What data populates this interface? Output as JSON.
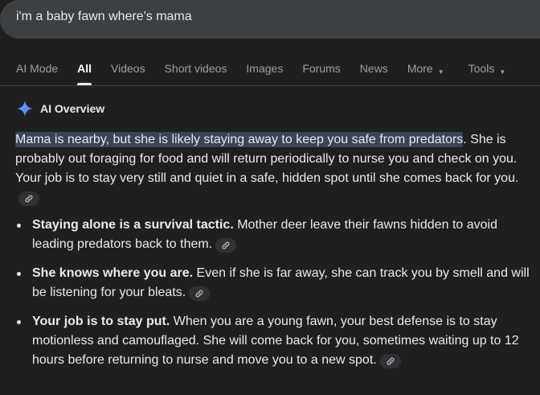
{
  "search": {
    "query": "i'm a baby fawn where's mama"
  },
  "tabs": [
    {
      "label": "AI Mode",
      "active": false,
      "dropdown": false
    },
    {
      "label": "All",
      "active": true,
      "dropdown": false
    },
    {
      "label": "Videos",
      "active": false,
      "dropdown": false
    },
    {
      "label": "Short videos",
      "active": false,
      "dropdown": false
    },
    {
      "label": "Images",
      "active": false,
      "dropdown": false
    },
    {
      "label": "Forums",
      "active": false,
      "dropdown": false
    },
    {
      "label": "News",
      "active": false,
      "dropdown": false
    },
    {
      "label": "More",
      "active": false,
      "dropdown": true
    },
    {
      "label": "Tools",
      "active": false,
      "dropdown": true
    }
  ],
  "ai_overview": {
    "title": "AI Overview",
    "icon": "sparkle-icon",
    "intro_highlight": "Mama is nearby, but she is likely staying away to keep you safe from predators",
    "intro_rest": ". She is probably out foraging for food and will return periodically to nurse you and check on you. Your job is to stay very still and quiet in a safe, hidden spot until she comes back for you.",
    "bullets": [
      {
        "bold": "Staying alone is a survival tactic.",
        "text": " Mother deer leave their fawns hidden to avoid leading predators back to them."
      },
      {
        "bold": "She knows where you are.",
        "text": " Even if she is far away, she can track you by smell and will be listening for your bleats."
      },
      {
        "bold": "Your job is to stay put.",
        "text": " When you are a young fawn, your best defense is to stay motionless and camouflaged. She will come back for you, sometimes waiting up to 12 hours before returning to nurse and move you to a new spot."
      }
    ]
  },
  "colors": {
    "background": "#1f1f1f",
    "search_bar": "#3c4043",
    "highlight": "#394457",
    "muted_text": "#9aa0a6"
  }
}
